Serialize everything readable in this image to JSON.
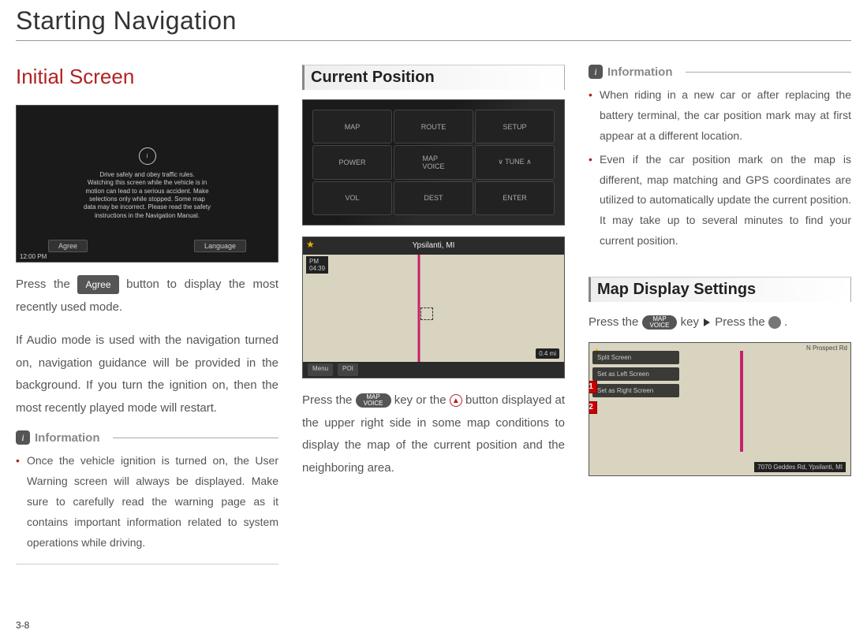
{
  "page_title": "Starting Navigation",
  "page_number": "3-8",
  "col1": {
    "heading": "Initial Screen",
    "warning_screen": {
      "text": "Drive safely and obey traffic rules.\nWatching this screen while the vehicle is in\nmotion can lead to a serious accident. Make\nselections only while stopped. Some map\ndata may be incorrect. Please read the safety\ninstructions in the Navigation Manual.",
      "btn_agree": "Agree",
      "btn_language": "Language",
      "time": "12:00 PM"
    },
    "body_pre": "Press the ",
    "agree_label": "Agree",
    "body_post": " button to display the most recently used mode.",
    "body_2": "If Audio mode is used with the navigation turned on, navigation guidance will be provided in the background. If you turn the ignition on, then the most recently played mode will restart.",
    "info_title": "Information",
    "info_item": "Once the vehicle ignition is turned on, the User Warning screen will always be displayed. Make sure to carefully read the warning page as it contains important information related to system operations while driving."
  },
  "col2": {
    "heading": "Current Position",
    "dash_labels": {
      "map": "MAP",
      "route": "ROUTE",
      "setup": "SETUP",
      "power": "POWER",
      "mapvoice": "MAP\nVOICE",
      "tune": "∨  TUNE  ∧",
      "vol": "VOL",
      "dest": "DEST",
      "enter": "ENTER"
    },
    "map": {
      "header": "Ypsilanti, MI",
      "time": "PM\n04:39",
      "menu": "Menu",
      "poi": "POI",
      "dist": "0.4 mi"
    },
    "body_pre": "Press the ",
    "key_top": "MAP",
    "key_bot": "VOICE",
    "body_mid": " key or the ",
    "body_post": " button displayed at the upper right side in some map conditions to display the map of the current position and the neighboring area."
  },
  "col3": {
    "info_title": "Information",
    "info_item1": "When riding in a new car or after replacing the battery terminal, the car position mark may at first appear at a different location.",
    "info_item2": "Even if the car position mark on the map is different, map matching and GPS coordinates are utilized to automatically update the current position. It may take up to several minutes to find your current position.",
    "heading": "Map Display Settings",
    "body_pre": "Press the ",
    "key_top": "MAP",
    "key_bot": "VOICE",
    "body_mid": " key",
    "body_mid2": " Press the ",
    "body_post": " .",
    "map": {
      "opt1": "Split Screen",
      "opt2": "Set as Left Screen",
      "opt3": "Set as Right Screen",
      "callout1": "1",
      "callout2": "2",
      "addr": "7070 Geddes Rd, Ypsilanti, MI",
      "corner": "N Prospect Rd"
    }
  }
}
